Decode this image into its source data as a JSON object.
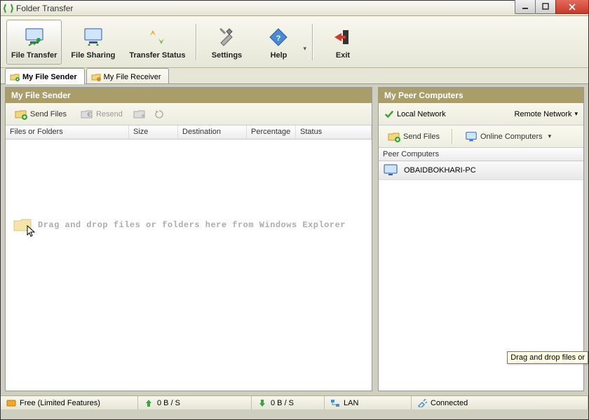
{
  "window": {
    "title": "Folder Transfer"
  },
  "toolbar": {
    "file_transfer": "File Transfer",
    "file_sharing": "File Sharing",
    "transfer_status": "Transfer Status",
    "settings": "Settings",
    "help": "Help",
    "exit": "Exit"
  },
  "tabs": {
    "sender": "My File Sender",
    "receiver": "My File Receiver"
  },
  "left_panel": {
    "title": "My File Sender",
    "send_files": "Send Files",
    "resend": "Resend",
    "columns": {
      "files": "Files or Folders",
      "size": "Size",
      "destination": "Destination",
      "percentage": "Percentage",
      "status": "Status"
    },
    "drop_hint": "Drag and drop files or folders here from Windows Explorer"
  },
  "right_panel": {
    "title": "My Peer Computers",
    "local_network": "Local Network",
    "remote_network": "Remote Network",
    "send_files": "Send Files",
    "online_computers": "Online Computers",
    "peer_header": "Peer Computers",
    "peers": [
      {
        "name": "OBAIDBOKHARI-PC"
      }
    ]
  },
  "status": {
    "edition": "Free (Limited Features)",
    "up_rate": "0 B / S",
    "down_rate": "0 B / S",
    "network": "LAN",
    "connection": "Connected"
  },
  "tooltip": "Drag and drop files or"
}
